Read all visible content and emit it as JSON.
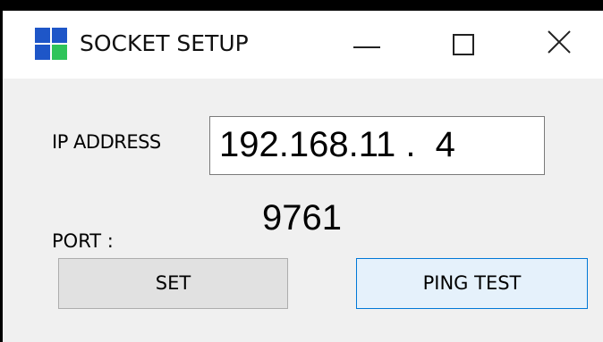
{
  "window": {
    "title": "SOCKET SETUP"
  },
  "titlebar": {
    "app_icon": "four-squares-app-icon",
    "minimize_icon": "minimize-icon",
    "maximize_icon": "maximize-icon",
    "close_icon": "close-icon"
  },
  "form": {
    "ip_label": "IP ADDRESS",
    "ip_value": "192.168.11 .  4",
    "port_label": "PORT :",
    "port_value": "9761"
  },
  "buttons": {
    "set_label": "SET",
    "ping_label": "PING TEST"
  },
  "colors": {
    "icon_blue": "#1e56c8",
    "icon_green": "#2fc45a",
    "ping_border": "#0078d7",
    "ping_background": "#e5f1fb",
    "set_background": "#e1e1e1"
  }
}
